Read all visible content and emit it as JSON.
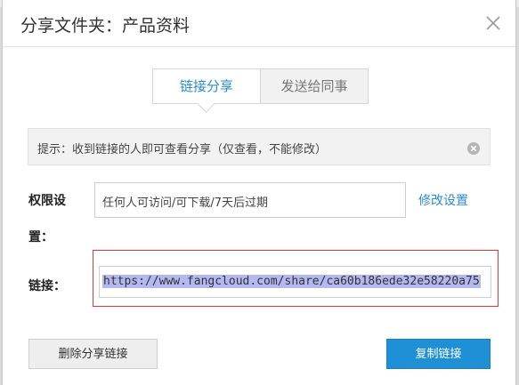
{
  "dialog": {
    "title": "分享文件夹：产品资料"
  },
  "tabs": [
    {
      "label": "链接分享",
      "active": true
    },
    {
      "label": "发送给同事",
      "active": false
    }
  ],
  "notice": {
    "text": "提示：收到链接的人即可查看分享（仅查看，不能修改）"
  },
  "permission": {
    "label_line1": "权限设",
    "label_line2": "置：",
    "value": "任何人可访问/可下载/7天后过期",
    "modify_label": "修改设置"
  },
  "link": {
    "label": "链接：",
    "url": "https://www.fangcloud.com/share/ca60b186ede32e58220a75"
  },
  "buttons": {
    "delete_label": "删除分享链接",
    "copy_label": "复制链接"
  },
  "colors": {
    "accent": "#2a8ad4",
    "primary_button": "#1f8fd6",
    "highlight_border": "#d63a3a",
    "selection": "#b4b8f0"
  }
}
